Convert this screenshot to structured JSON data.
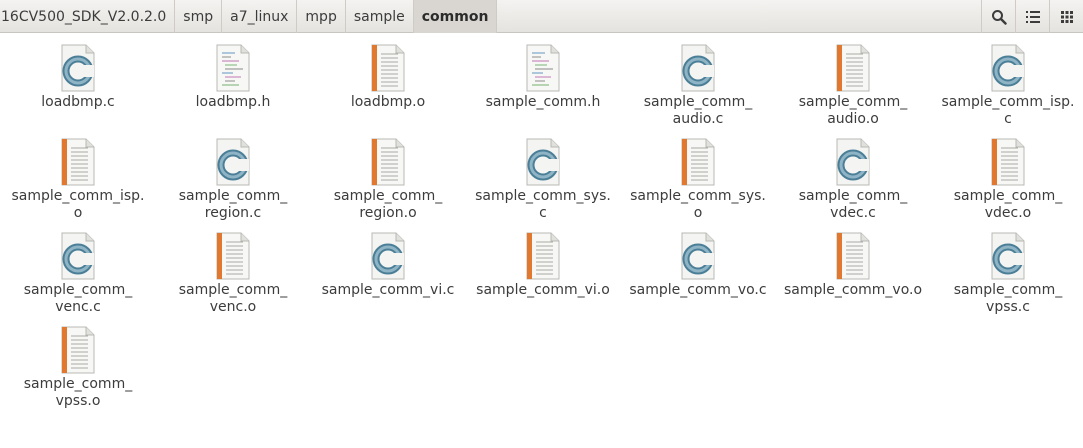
{
  "breadcrumb": [
    "16CV500_SDK_V2.0.2.0",
    "smp",
    "a7_linux",
    "mpp",
    "sample",
    "common"
  ],
  "toolbar": {
    "search_icon": "search-icon",
    "list_icon": "list-view-icon",
    "grid_icon": "grid-view-icon"
  },
  "files": [
    {
      "name": "loadbmp.c",
      "type": "c"
    },
    {
      "name": "loadbmp.h",
      "type": "h"
    },
    {
      "name": "loadbmp.o",
      "type": "o"
    },
    {
      "name": "sample_comm.h",
      "type": "h"
    },
    {
      "name": "sample_comm_\naudio.c",
      "type": "c"
    },
    {
      "name": "sample_comm_\naudio.o",
      "type": "o"
    },
    {
      "name": "sample_comm_isp.\nc",
      "type": "c"
    },
    {
      "name": "sample_comm_isp.\no",
      "type": "o"
    },
    {
      "name": "sample_comm_\nregion.c",
      "type": "c"
    },
    {
      "name": "sample_comm_\nregion.o",
      "type": "o"
    },
    {
      "name": "sample_comm_sys.\nc",
      "type": "c"
    },
    {
      "name": "sample_comm_sys.\no",
      "type": "o"
    },
    {
      "name": "sample_comm_\nvdec.c",
      "type": "c"
    },
    {
      "name": "sample_comm_\nvdec.o",
      "type": "o"
    },
    {
      "name": "sample_comm_\nvenc.c",
      "type": "c"
    },
    {
      "name": "sample_comm_\nvenc.o",
      "type": "o"
    },
    {
      "name": "sample_comm_vi.c",
      "type": "c"
    },
    {
      "name": "sample_comm_vi.o",
      "type": "o"
    },
    {
      "name": "sample_comm_vo.c",
      "type": "c"
    },
    {
      "name": "sample_comm_vo.o",
      "type": "o"
    },
    {
      "name": "sample_comm_\nvpss.c",
      "type": "c"
    },
    {
      "name": "sample_comm_\nvpss.o",
      "type": "o"
    }
  ]
}
